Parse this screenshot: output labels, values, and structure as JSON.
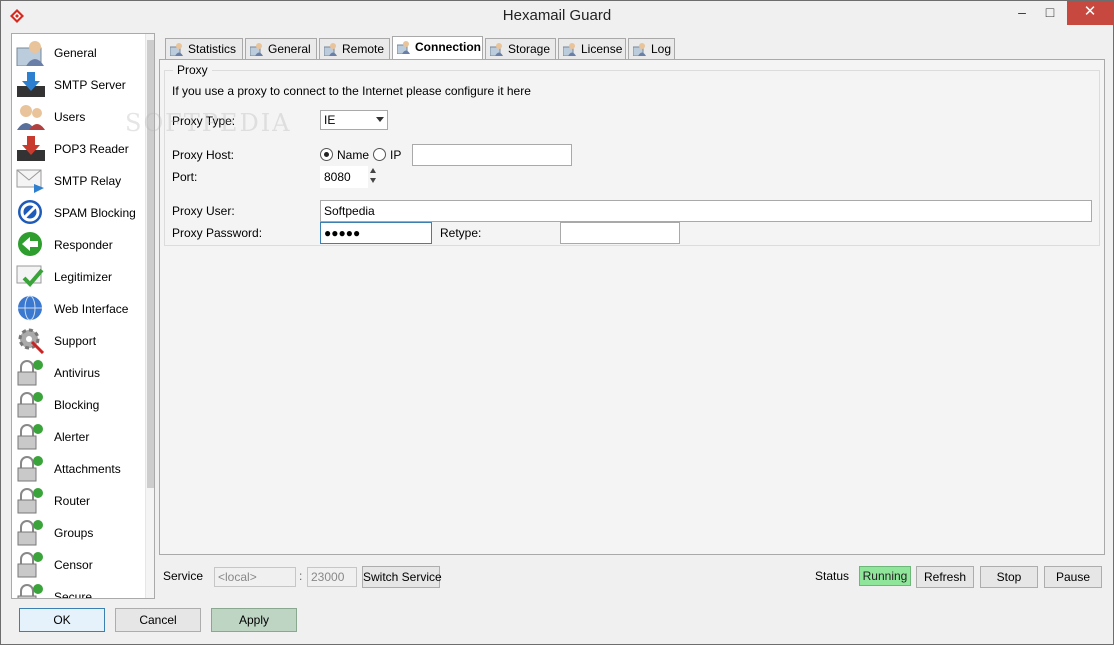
{
  "window": {
    "title": "Hexamail Guard",
    "minimize": "–",
    "maximize": "□",
    "close": "✕"
  },
  "watermark": "SOFTPEDIA",
  "sidebar": {
    "items": [
      {
        "label": "General",
        "icon": "user-icon"
      },
      {
        "label": "SMTP Server",
        "icon": "download-tray-icon"
      },
      {
        "label": "Users",
        "icon": "users-icon"
      },
      {
        "label": "POP3 Reader",
        "icon": "download-tray-icon"
      },
      {
        "label": "SMTP Relay",
        "icon": "envelope-arrow-icon"
      },
      {
        "label": "SPAM Blocking",
        "icon": "block-icon"
      },
      {
        "label": "Responder",
        "icon": "back-arrow-icon"
      },
      {
        "label": "Legitimizer",
        "icon": "check-envelope-icon"
      },
      {
        "label": "Web Interface",
        "icon": "globe-icon"
      },
      {
        "label": "Support",
        "icon": "gear-wrench-icon"
      },
      {
        "label": "Antivirus",
        "icon": "lock-icon"
      },
      {
        "label": "Blocking",
        "icon": "lock-icon"
      },
      {
        "label": "Alerter",
        "icon": "lock-icon"
      },
      {
        "label": "Attachments",
        "icon": "lock-icon"
      },
      {
        "label": "Router",
        "icon": "lock-icon"
      },
      {
        "label": "Groups",
        "icon": "lock-icon"
      },
      {
        "label": "Censor",
        "icon": "lock-icon"
      },
      {
        "label": "Secure",
        "icon": "lock-icon"
      }
    ]
  },
  "tabs": [
    {
      "label": "Statistics"
    },
    {
      "label": "General"
    },
    {
      "label": "Remote"
    },
    {
      "label": "Connection",
      "active": true
    },
    {
      "label": "Storage"
    },
    {
      "label": "License"
    },
    {
      "label": "Log"
    }
  ],
  "proxy": {
    "group_title": "Proxy",
    "description": "If you use a proxy to connect to the Internet please configure it here",
    "type_label": "Proxy Type:",
    "type_value": "IE",
    "host_label": "Proxy Host:",
    "host_mode_name": "Name",
    "host_mode_ip": "IP",
    "host_mode_selected": "Name",
    "host_value": "",
    "port_label": "Port:",
    "port_value": "8080",
    "user_label": "Proxy User:",
    "user_value": "Softpedia",
    "password_label": "Proxy Password:",
    "password_value": "●●●●●",
    "retype_label": "Retype:",
    "retype_value": ""
  },
  "service": {
    "label": "Service",
    "host_value": "<local>",
    "separator": ":",
    "port_value": "23000",
    "switch_label": "Switch Service",
    "status_label": "Status",
    "status_value": "Running",
    "refresh_label": "Refresh",
    "stop_label": "Stop",
    "pause_label": "Pause"
  },
  "dialog": {
    "ok_label": "OK",
    "cancel_label": "Cancel",
    "apply_label": "Apply"
  },
  "colors": {
    "close_button": "#c7483f",
    "running": "#8fe59a",
    "focus": "#3c7fb1"
  }
}
